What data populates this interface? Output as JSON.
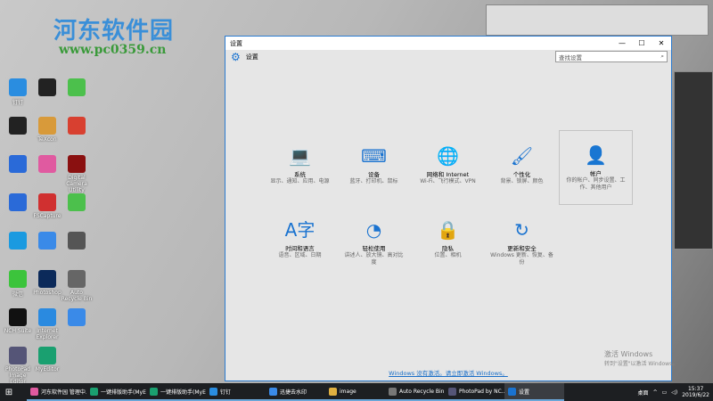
{
  "watermark": {
    "name": "河东软件园",
    "url": "www.pc0359.cn"
  },
  "desktop_icons": [
    {
      "label": "钉钉",
      "color": "#2a8de0"
    },
    {
      "label": "",
      "color": "#222"
    },
    {
      "label": "",
      "color": "#4cc04c"
    },
    {
      "label": "",
      "color": "#222"
    },
    {
      "label": "TeXcon",
      "color": "#d89a3a"
    },
    {
      "label": "",
      "color": "#d84030"
    },
    {
      "label": "",
      "color": "#2a6ad8"
    },
    {
      "label": "",
      "color": "#e05aa0"
    },
    {
      "label": "Digital Camera Utility",
      "color": "#8a1010"
    },
    {
      "label": "",
      "color": "#2a6ad8"
    },
    {
      "label": "FSCapture",
      "color": "#d03030"
    },
    {
      "label": "",
      "color": "#4cc04c"
    },
    {
      "label": "",
      "color": "#1a9ae0"
    },
    {
      "label": "",
      "color": "#3a8ae8"
    },
    {
      "label": "",
      "color": "#555"
    },
    {
      "label": "微信",
      "color": "#3cc43c"
    },
    {
      "label": "Photoshop",
      "color": "#0c2a5a"
    },
    {
      "label": "Auto Recycle Bin",
      "color": "#666"
    },
    {
      "label": "NCH Suite",
      "color": "#111"
    },
    {
      "label": "Internet Explorer",
      "color": "#2a8ae0"
    },
    {
      "label": "",
      "color": "#3a8ae8"
    },
    {
      "label": "PhotoPad Image Editor",
      "color": "#557"
    },
    {
      "label": "MyEditor",
      "color": "#1aa070"
    }
  ],
  "window": {
    "title": "设置",
    "controls": [
      "—",
      "☐",
      "✕"
    ],
    "header": "设置",
    "search": {
      "placeholder": "查找设置",
      "icon": "search-icon"
    },
    "tiles": [
      {
        "icon": "laptop",
        "glyph": "💻",
        "label": "系统",
        "desc": "显示、通知、应用、电源"
      },
      {
        "icon": "keyboard",
        "glyph": "⌨",
        "label": "设备",
        "desc": "蓝牙、打印机、鼠标"
      },
      {
        "icon": "globe",
        "glyph": "🌐",
        "label": "网络和 Internet",
        "desc": "Wi-Fi、飞行模式、VPN"
      },
      {
        "icon": "paint",
        "glyph": "🖌",
        "label": "个性化",
        "desc": "背景、锁屏、颜色"
      },
      {
        "icon": "person",
        "glyph": "👤",
        "label": "帐户",
        "desc": "你的帐户、同步设置、工作、其他用户"
      },
      {
        "icon": "time-language",
        "glyph": "A字",
        "label": "时间和语言",
        "desc": "语音、区域、日期"
      },
      {
        "icon": "ease-of-access",
        "glyph": "◔",
        "label": "轻松使用",
        "desc": "讲述人、放大镜、高对比度"
      },
      {
        "icon": "lock",
        "glyph": "🔒",
        "label": "隐私",
        "desc": "位置、相机"
      },
      {
        "icon": "refresh",
        "glyph": "↻",
        "label": "更新和安全",
        "desc": "Windows 更新、恢复、备份"
      }
    ],
    "activate_link": "Windows 没有激活。请立即激活 Windows。"
  },
  "activation": {
    "title": "激活 Windows",
    "sub": "转到\"设置\"以激活 Windows。"
  },
  "taskbar": {
    "items": [
      {
        "label": "河东软件园 管理中...",
        "color": "#e05aa0"
      },
      {
        "label": "一键排版助手(MyE...",
        "color": "#1aa070"
      },
      {
        "label": "一键排版助手(MyE...",
        "color": "#1aa070"
      },
      {
        "label": "钉钉",
        "color": "#2a8de0"
      },
      {
        "label": "迅捷去水印",
        "color": "#3a8ae8"
      },
      {
        "label": "image",
        "color": "#e0b040"
      },
      {
        "label": "Auto Recycle Bin ...",
        "color": "#777"
      },
      {
        "label": "PhotoPad by NC...",
        "color": "#557"
      },
      {
        "label": "设置",
        "color": "#1a73d0"
      }
    ],
    "tray_label": "桌面",
    "time": "15:37",
    "date": "2019/6/22"
  }
}
